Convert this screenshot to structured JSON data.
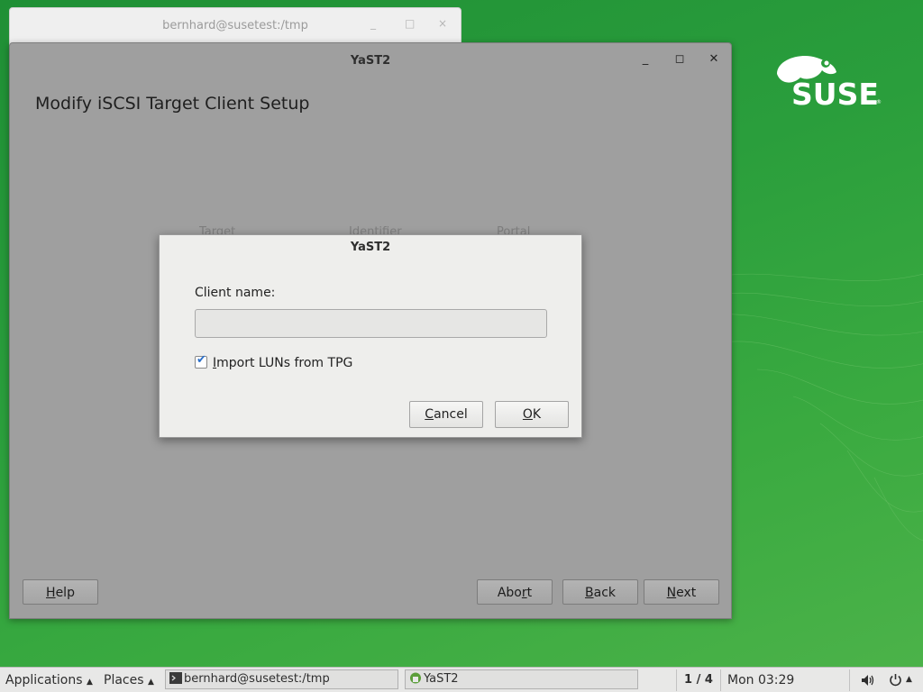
{
  "colors": {
    "desktop_green": "#2a9e3c",
    "dialog_background": "#eeeeec",
    "dimmed_window": "#9f9f9f",
    "checkbox_accent": "#2a6fc9"
  },
  "background_window": {
    "title": "bernhard@susetest:/tmp",
    "minimize": "_",
    "maximize": "□",
    "close": "×"
  },
  "main_window": {
    "title": "YaST2",
    "page_title": "Modify iSCSI Target Client Setup",
    "minimize": "_",
    "maximize": "◻",
    "close": "✕",
    "table_headers": [
      "Target",
      "Identifier",
      "Portal"
    ],
    "buttons": {
      "help": {
        "mnemonic": "H",
        "rest": "elp"
      },
      "abort": {
        "before": "Abo",
        "mnemonic": "r",
        "rest": "t"
      },
      "back": {
        "mnemonic": "B",
        "rest": "ack"
      },
      "next": {
        "mnemonic": "N",
        "rest": "ext"
      }
    }
  },
  "dialog": {
    "title": "YaST2",
    "client_name_label": "Client name:",
    "client_name_value": "",
    "import_luns": {
      "checked": true,
      "mnemonic": "I",
      "rest": "mport LUNs from TPG"
    },
    "cancel": {
      "mnemonic": "C",
      "rest": "ancel"
    },
    "ok": {
      "mnemonic": "O",
      "rest": "K"
    }
  },
  "taskbar": {
    "applications": "Applications",
    "places": "Places",
    "tasks": [
      {
        "label": "bernhard@susetest:/tmp",
        "icon": "terminal-icon"
      },
      {
        "label": "YaST2",
        "icon": "yast-icon"
      }
    ],
    "workspace": "1 / 4",
    "clock": "Mon 03:29",
    "volume_icon": "volume-icon",
    "power_icon": "power-icon"
  }
}
